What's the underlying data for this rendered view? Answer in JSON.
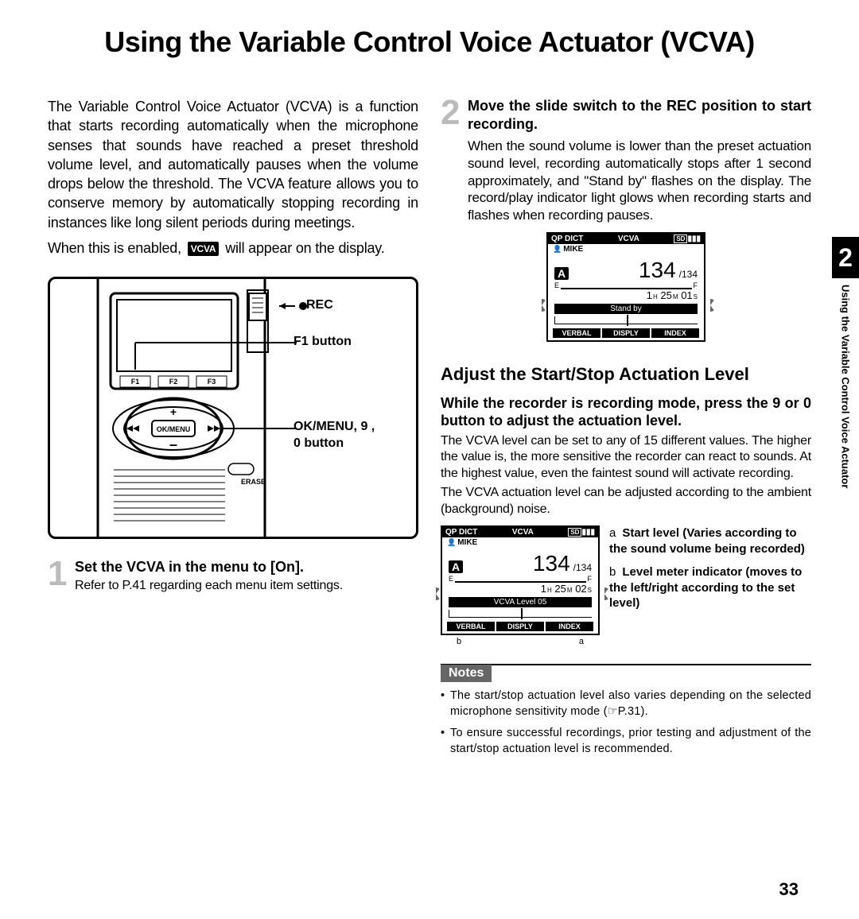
{
  "title": "Using the Variable Control Voice Actuator (VCVA)",
  "intro_part1": "The Variable Control Voice Actuator (VCVA) is a function that starts recording automatically when the microphone senses that sounds have reached a preset threshold volume level, and automatically pauses when the volume drops below the threshold. The VCVA feature allows you to conserve memory by automatically stopping recording in instances like long silent periods during meetings.",
  "intro_part2a": "When this is enabled,",
  "intro_badge": "VCVA",
  "intro_part2b": "will appear on the display.",
  "labels": {
    "rec": "REC",
    "f1": "F1 button",
    "okmenu": "OK/MENU, 9     ,",
    "okmenu2": "0     button"
  },
  "step1_num": "1",
  "step1_head": "Set the VCVA in the menu to [On].",
  "step1_body": "Refer to P.41 regarding each menu item settings.",
  "step2_num": "2",
  "step2_head_a": "Move the slide switch to the ",
  "step2_head_rec": "REC",
  "step2_head_b": " position to start recording.",
  "step2_body": "When the sound volume is lower than the preset actuation sound level, recording automatically stops after 1 second approximately, and \"Stand by\" flashes on the display. The record/play indicator light glows when recording starts and flashes when recording pauses.",
  "lcd": {
    "top": [
      "QP DICT",
      "VCVA"
    ],
    "sd": "SD",
    "mike": "MIKE",
    "folder": "A",
    "count": "134",
    "total": "/134",
    "e": "E",
    "f": "F",
    "h": "1",
    "m": "25",
    "s1": "01",
    "s2": "02",
    "hu": "H",
    "mu": "M",
    "su": "S",
    "standby": "Stand by",
    "level": "VCVA Level 05",
    "verbal": "VERBAL",
    "disply": "DISPLY",
    "index": "INDEX",
    "b_label": "b",
    "a_label": "a"
  },
  "subhead": "Adjust the Start/Stop Actuation Level",
  "adjust_head": "While the recorder is recording mode, press the 9       or 0       button to adjust the actuation level.",
  "adjust_body1": "The VCVA level can be set to any of 15 different values. The higher the value is, the more sensitive the recorder can react to sounds. At the highest value, even the faintest sound will activate recording.",
  "adjust_body2": "The VCVA actuation level can be adjusted according to the ambient (background) noise.",
  "info_a_key": "a",
  "info_a": "Start level (Varies according to the sound volume being recorded)",
  "info_b_key": "b",
  "info_b": "Level meter indicator (moves to the left/right according to the set level)",
  "notes_label": "Notes",
  "note1": "The start/stop actuation level also varies depending on the selected microphone sensitivity mode (☞P.31).",
  "note2": "To ensure successful recordings, prior testing and adjustment of the start/stop actuation level is recommended.",
  "sidetab_num": "2",
  "sidetab_text": "Using the Variable Control Voice Actuator",
  "page_number": "33"
}
